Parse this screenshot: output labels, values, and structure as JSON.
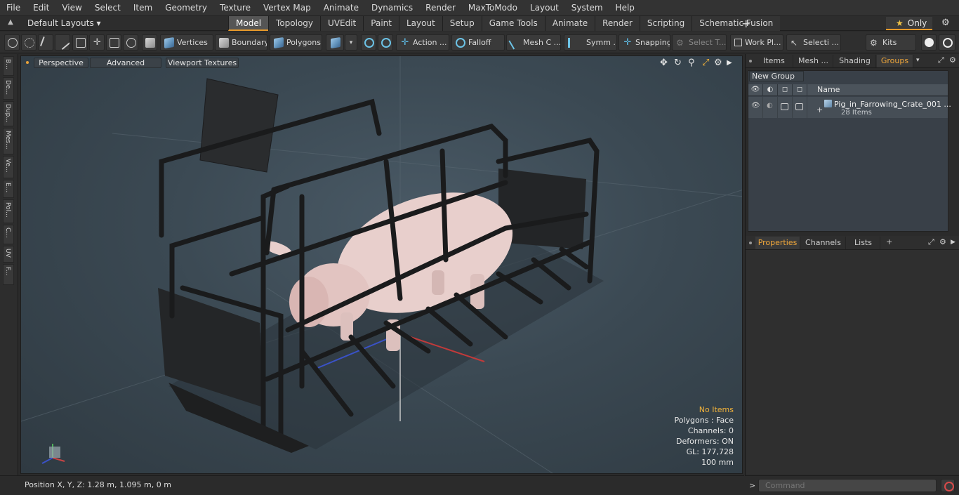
{
  "menu": [
    "File",
    "Edit",
    "View",
    "Select",
    "Item",
    "Geometry",
    "Texture",
    "Vertex Map",
    "Animate",
    "Dynamics",
    "Render",
    "MaxToModo",
    "Layout",
    "System",
    "Help"
  ],
  "layout": {
    "dropdown": "Default Layouts ▾",
    "tabs": [
      "Model",
      "Topology",
      "UVEdit",
      "Paint",
      "Layout",
      "Setup",
      "Game Tools",
      "Animate",
      "Render",
      "Scripting",
      "Schematic Fusion"
    ],
    "active_tab": "Model",
    "add_icon": "+",
    "only_label": "Only",
    "star_icon": "★",
    "gear_icon": "⚙"
  },
  "toolbar": {
    "vertices": "Vertices",
    "boundary": "Boundary",
    "polygons": "Polygons",
    "action": "Action ...",
    "falloff": "Falloff",
    "mesh": "Mesh C ...",
    "symm": "Symm ...",
    "snapping": "Snapping",
    "select_t": "Select T...",
    "workplane": "Work Pl...",
    "selecti": "Selecti ...",
    "kits": "Kits"
  },
  "left_tabs": [
    "B...",
    "De...",
    "Dup...",
    "Mes...",
    "Ve...",
    "E...",
    "Pol...",
    "C...",
    "UV",
    "F..."
  ],
  "viewport": {
    "perspective": "Perspective",
    "advanced": "Advanced",
    "viewport_textures": "Viewport Textures",
    "info": {
      "no_items": "No Items",
      "polygons": "Polygons : Face",
      "channels": "Channels: 0",
      "deformers": "Deformers: ON",
      "gl": "GL: 177,728",
      "scale": "100 mm"
    }
  },
  "right_panel": {
    "top_tabs": [
      "Items",
      "Mesh ...",
      "Shading",
      "Groups"
    ],
    "active_top_tab": "Groups",
    "new_group": "New Group",
    "name_col": "Name",
    "group_name": "Pig_in_Farrowing_Crate_001 ...",
    "group_count": "28 Items",
    "bottom_tabs": [
      "Properties",
      "Channels",
      "Lists"
    ],
    "active_bottom_tab": "Properties",
    "add_icon": "+"
  },
  "command": {
    "placeholder": "Command"
  },
  "status": {
    "position": "Position X, Y, Z:   1.28 m, 1.095 m, 0 m"
  },
  "colors": {
    "accent": "#e89a2b",
    "active_tab_text": "#f0a73a",
    "no_items": "#f2b33a"
  }
}
